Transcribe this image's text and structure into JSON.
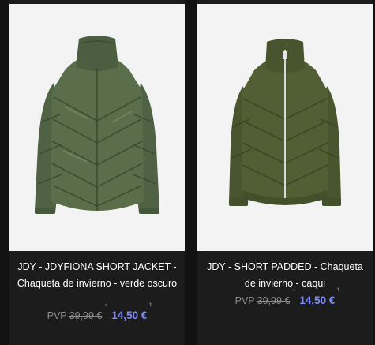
{
  "products": [
    {
      "image_alt": "Green short puffer jacket",
      "title": "JDY - JDYFIONA SHORT JACKET - Chaqueta de invierno - verde oscuro",
      "pvp_label": "PVP",
      "old_price": "39,99 €",
      "old_price_note": "*",
      "new_price": "14,50 €",
      "new_price_note": "1"
    },
    {
      "image_alt": "Khaki short padded jacket with zip",
      "title": "JDY - SHORT PADDED - Chaqueta de invierno - caqui",
      "pvp_label": "PVP",
      "old_price": "39,99 €",
      "old_price_note": "*",
      "new_price": "14,50 €",
      "new_price_note": "1"
    }
  ],
  "colors": {
    "page_bg": "#121212",
    "card_bg": "#1c1c1c",
    "image_bg": "#f3f3f3",
    "sale_price": "#7c8cff",
    "jacket_green": "#566848",
    "jacket_khaki": "#4c5a32"
  }
}
